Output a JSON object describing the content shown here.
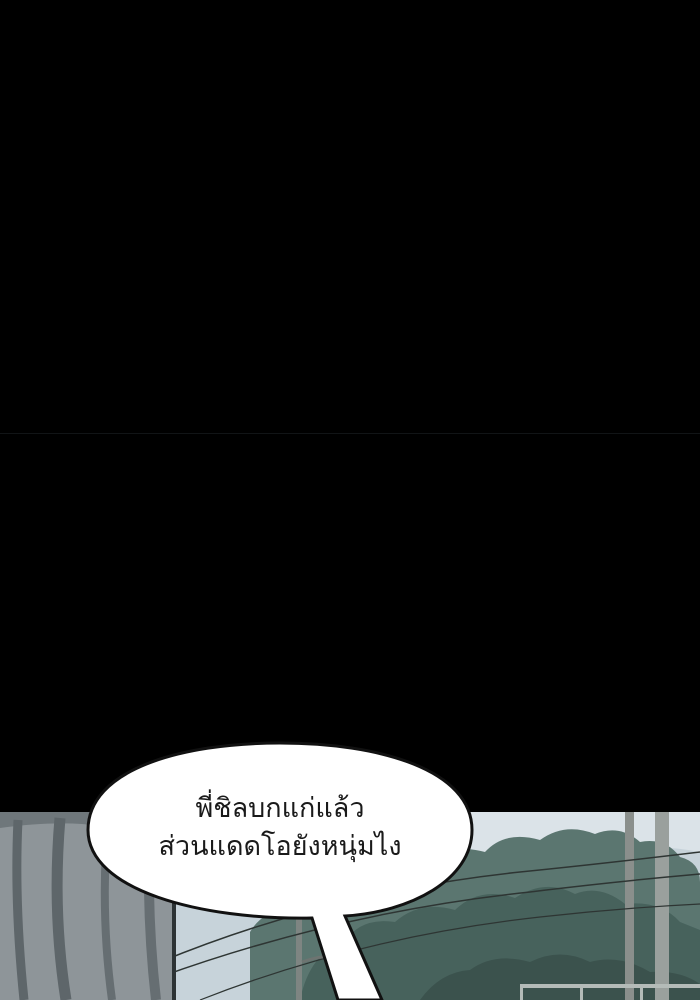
{
  "speech": {
    "lines": [
      "พี่ชิลบกแก่แล้ว",
      "ส่วนแดดโอยังหนุ่มไง"
    ]
  },
  "colors": {
    "background": "#000000",
    "bubble_fill": "#ffffff",
    "bubble_outline": "#111111",
    "sky": "#c9d5dc",
    "foliage": "#4e6a64",
    "curtain": "#8f969a"
  }
}
